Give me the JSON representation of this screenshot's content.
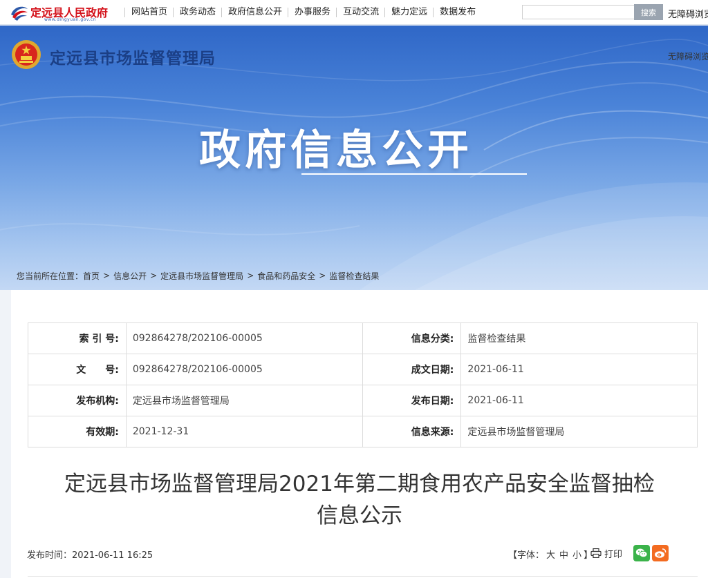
{
  "topbar": {
    "logo_text": "定远县人民政府",
    "logo_subtext": "www.dingyuan.gov.cn",
    "nav": [
      "网站首页",
      "政务动态",
      "政府信息公开",
      "办事服务",
      "互动交流",
      "魅力定远",
      "数据发布"
    ],
    "search_placeholder": "",
    "search_label": "搜索",
    "accessibility_label": "无障碍浏览"
  },
  "banner": {
    "agency_name": "定远县市场监督管理局",
    "accessibility_label": "无障碍浏览",
    "title": "政府信息公开"
  },
  "breadcrumb": {
    "prefix": "您当前所在位置：",
    "items": [
      "首页",
      "信息公开",
      "定远县市场监督管理局",
      "食品和药品安全",
      "监督检查结果"
    ],
    "separator": ">"
  },
  "meta": {
    "rows": [
      [
        {
          "label": "索 引 号:",
          "value": "092864278/202106-00005"
        },
        {
          "label": "信息分类:",
          "value": "监督检查结果"
        }
      ],
      [
        {
          "label": "文　　号:",
          "value": "092864278/202106-00005"
        },
        {
          "label": "成文日期:",
          "value": "2021-06-11"
        }
      ],
      [
        {
          "label": "发布机构:",
          "value": "定远县市场监督管理局"
        },
        {
          "label": "发布日期:",
          "value": "2021-06-11"
        }
      ],
      [
        {
          "label": "有效期:",
          "value": "2021-12-31"
        },
        {
          "label": "信息来源:",
          "value": "定远县市场监督管理局"
        }
      ]
    ]
  },
  "article": {
    "title_line1": "定远县市场监督管理局2021年第二期食用农产品安全监督抽检",
    "title_line2": "信息公示",
    "publish_time": "发布时间：2021-06-11 16:25"
  },
  "tools": {
    "font_label": "【字体：",
    "font_large": "大",
    "font_medium": "中",
    "font_small": "小",
    "font_close": "】",
    "print_label": "打印"
  },
  "colors": {
    "banner_top": "#2f67c7",
    "logo_red": "#d4111a",
    "agency_blue": "#1b3f86",
    "wechat_green": "#3bb34a",
    "weibo_orange": "#f36b21"
  },
  "icons": [
    "gov-emblem-icon",
    "search-icon",
    "printer-icon",
    "wechat-icon",
    "weibo-icon"
  ]
}
